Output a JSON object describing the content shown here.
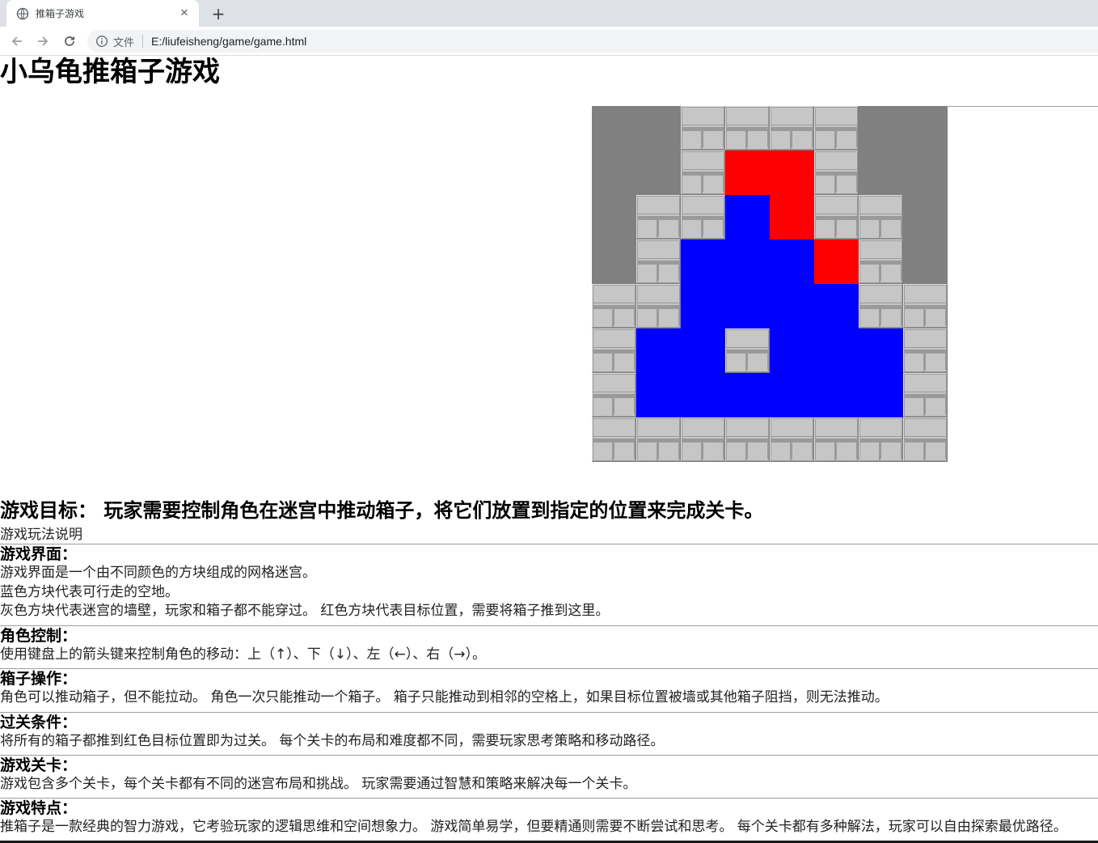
{
  "browser": {
    "tab": {
      "title": "推箱子游戏",
      "favicon": "globe-icon",
      "close_glyph": "✕"
    },
    "new_tab_glyph": "+",
    "omnibox": {
      "scheme_label": "文件",
      "url": "E:/liufeisheng/game/game.html"
    }
  },
  "page": {
    "title": "小乌龟推箱子游戏",
    "board": {
      "legend_colors": {
        "floor": "#0000ff",
        "wall": "#c6c6c6",
        "target": "#ff0000",
        "outside": "#808080"
      },
      "grid": [
        "OWWWWO",
        "OWTTWO",
        "WWFTWW",
        "WFFFTW",
        "WWFFFWW",
        "WFWFFFW",
        "WFFFFFW",
        "WWWWWWWW"
      ],
      "rows": [
        [
          "outside",
          "outside",
          "wall",
          "wall",
          "wall",
          "wall",
          "outside",
          "outside"
        ],
        [
          "outside",
          "outside",
          "wall",
          "target",
          "target",
          "wall",
          "outside",
          "outside"
        ],
        [
          "outside",
          "wall",
          "wall",
          "floor",
          "target",
          "wall",
          "wall",
          "outside"
        ],
        [
          "outside",
          "wall",
          "floor",
          "floor",
          "floor",
          "target",
          "wall",
          "outside"
        ],
        [
          "wall",
          "wall",
          "floor",
          "floor",
          "floor",
          "floor",
          "wall",
          "wall"
        ],
        [
          "wall",
          "floor",
          "floor",
          "wall",
          "floor",
          "floor",
          "floor",
          "wall"
        ],
        [
          "wall",
          "floor",
          "floor",
          "floor",
          "floor",
          "floor",
          "floor",
          "wall"
        ],
        [
          "wall",
          "wall",
          "wall",
          "wall",
          "wall",
          "wall",
          "wall",
          "wall"
        ]
      ]
    },
    "goal": "游戏目标： 玩家需要控制角色在迷宫中推动箱子，将它们放置到指定的位置来完成关卡。",
    "rules_caption": "游戏玩法说明",
    "sections": {
      "interface": {
        "title": "游戏界面：",
        "lines": [
          "游戏界面是一个由不同颜色的方块组成的网格迷宫。",
          "蓝色方块代表可行走的空地。",
          "灰色方块代表迷宫的墙壁，玩家和箱子都不能穿过。 红色方块代表目标位置，需要将箱子推到这里。"
        ]
      },
      "control": {
        "title": "角色控制：",
        "lines": [
          "使用键盘上的箭头键来控制角色的移动：上（↑）、下（↓）、左（←）、右（→）。"
        ]
      },
      "box": {
        "title": "箱子操作：",
        "lines": [
          "角色可以推动箱子，但不能拉动。 角色一次只能推动一个箱子。 箱子只能推动到相邻的空格上，如果目标位置被墙或其他箱子阻挡，则无法推动。"
        ]
      },
      "clear": {
        "title": "过关条件：",
        "lines": [
          "将所有的箱子都推到红色目标位置即为过关。 每个关卡的布局和难度都不同，需要玩家思考策略和移动路径。"
        ]
      },
      "levels": {
        "title": "游戏关卡：",
        "lines": [
          "游戏包含多个关卡，每个关卡都有不同的迷宫布局和挑战。 玩家需要通过智慧和策略来解决每一个关卡。"
        ]
      },
      "features": {
        "title": "游戏特点：",
        "lines": [
          "推箱子是一款经典的智力游戏，它考验玩家的逻辑思维和空间想象力。 游戏简单易学，但要精通则需要不断尝试和思考。 每个关卡都有多种解法，玩家可以自由探索最优路径。"
        ]
      }
    }
  }
}
